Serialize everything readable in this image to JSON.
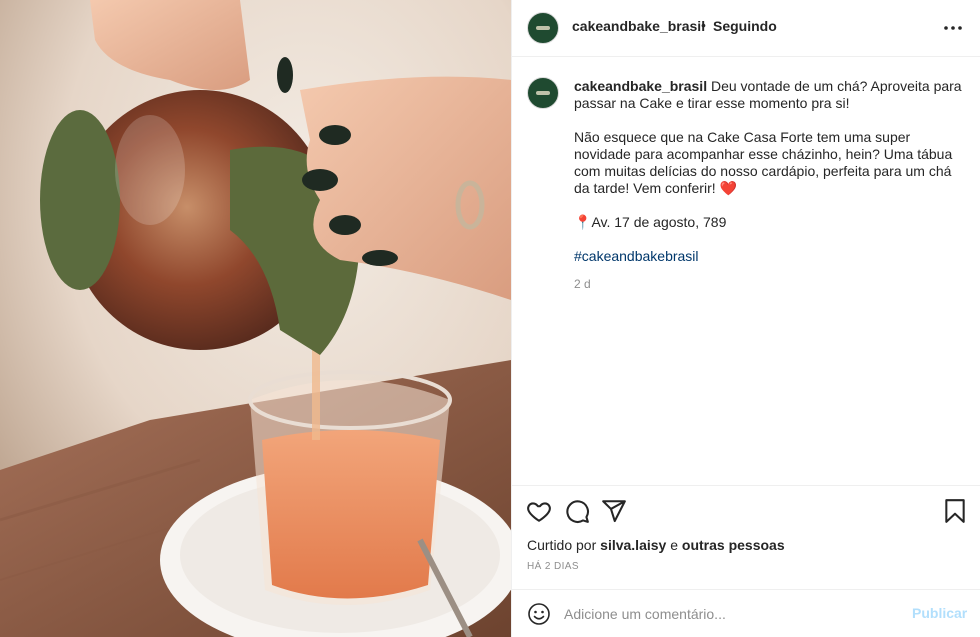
{
  "post": {
    "username": "cakeandbake_brasil",
    "follow_separator": "•",
    "follow_status": "Seguindo"
  },
  "caption": {
    "username": "cakeandbake_brasil",
    "line1": "Deu vontade de um chá? Aproveita para passar na Cake e tirar esse momento pra si!",
    "line2": "Não esquece que na Cake Casa Forte tem uma super novidade para acompanhar esse cházinho, hein? Uma tábua com muitas delícias do nosso cardápio, perfeita para um chá da tarde! Vem conferir!",
    "heart_emoji": "❤️",
    "pin_emoji": "📍",
    "address": "Av. 17 de agosto, 789",
    "hashtag": "#cakeandbakebrasil",
    "time": "2 d"
  },
  "actions": {
    "liked_by_prefix": "Curtido por",
    "liked_by_user": "silva.laisy",
    "liked_by_joiner": "e",
    "liked_by_others": "outras pessoas",
    "posted_ago": "HÁ 2 DIAS"
  },
  "comment": {
    "placeholder": "Adicione um comentário...",
    "publish_label": "Publicar"
  },
  "icons": {
    "like": "heart-icon",
    "comment": "comment-icon",
    "share": "paper-plane-icon",
    "save": "bookmark-icon",
    "more": "more-options-icon",
    "emoji": "emoji-icon"
  },
  "colors": {
    "link": "#00376b",
    "publish_disabled": "#b2dffc",
    "muted": "#8e8e8e",
    "avatar": "#1f4a30"
  }
}
